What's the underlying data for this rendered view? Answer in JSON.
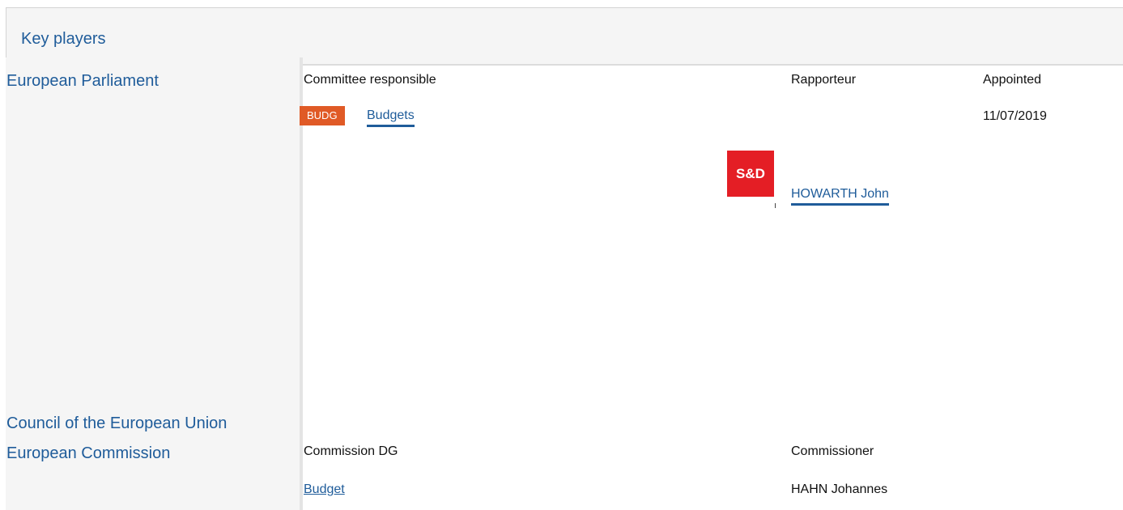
{
  "header": {
    "title": "Key players"
  },
  "parliament": {
    "label": "European Parliament",
    "columns": {
      "committee": "Committee responsible",
      "rapporteur": "Rapporteur",
      "appointed": "Appointed"
    },
    "committee": {
      "code": "BUDG",
      "name": "Budgets",
      "badge_color": "#e05a26"
    },
    "rapporteur": {
      "group_logo_text": "S&D",
      "group_color": "#e41e25",
      "name": "HOWARTH John"
    },
    "appointed_date": "11/07/2019"
  },
  "council": {
    "label": "Council of the European Union"
  },
  "commission": {
    "label": "European Commission",
    "columns": {
      "dg": "Commission DG",
      "commissioner": "Commissioner"
    },
    "dg": "Budget",
    "commissioner": "HAHN Johannes"
  }
}
